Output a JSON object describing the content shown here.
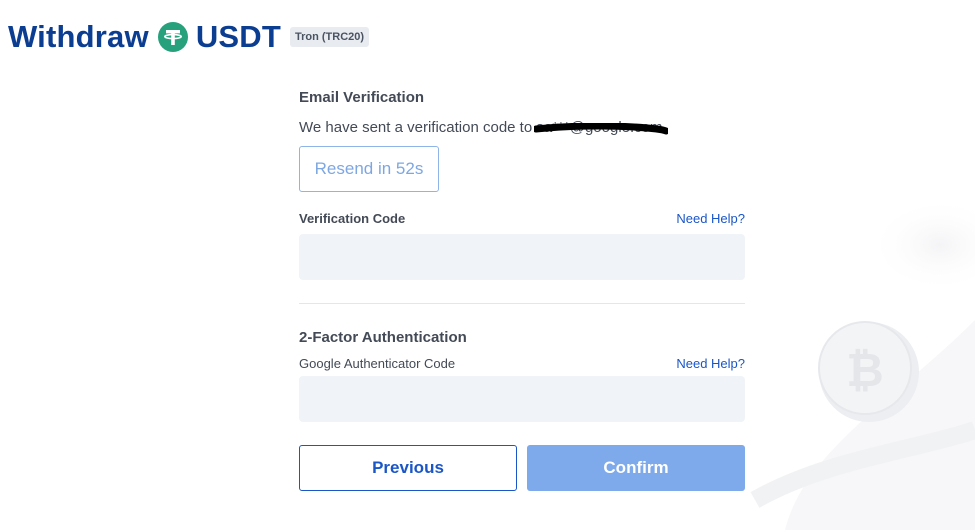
{
  "header": {
    "title_left": "Withdraw",
    "coin_icon": "tether-icon",
    "title_right": "USDT",
    "network_badge": "Tron (TRC20)"
  },
  "email_verification": {
    "title": "Email Verification",
    "sent_text": "We have sent a verification code to",
    "masked_email": "sa***@google.com",
    "resend_button": "Resend in 52s",
    "code_label": "Verification Code",
    "help_link": "Need Help?",
    "code_value": ""
  },
  "two_factor": {
    "title": "2-Factor Authentication",
    "code_label": "Google Authenticator Code",
    "help_link": "Need Help?",
    "code_value": ""
  },
  "actions": {
    "previous": "Previous",
    "confirm": "Confirm"
  },
  "colors": {
    "brand": "#0b3d91",
    "tether": "#26a17b",
    "link": "#1a56c8",
    "confirm_disabled": "#7ea9ea"
  }
}
